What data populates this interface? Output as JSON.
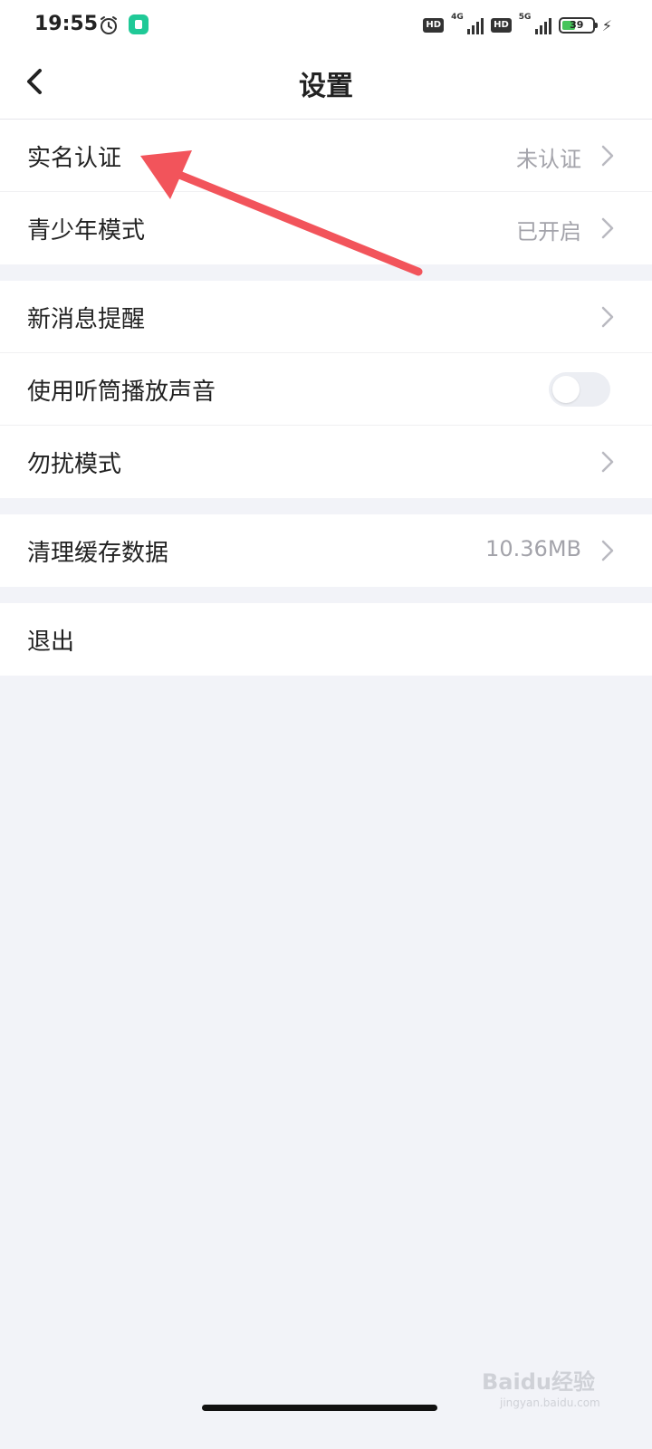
{
  "status_bar": {
    "time": "19:55",
    "hd_label_1": "HD",
    "network_1": "4G",
    "hd_label_2": "HD",
    "network_2": "5G",
    "battery_level": "39",
    "battery_color": "#45c45a",
    "icons": [
      "alarm-icon",
      "app-shield-icon",
      "signal-icon",
      "battery-icon",
      "charging-icon"
    ]
  },
  "header": {
    "title": "设置",
    "back_icon": "back-chevron-icon"
  },
  "groups": [
    {
      "items": [
        {
          "label": "实名认证",
          "value": "未认证",
          "control": "chevron"
        },
        {
          "label": "青少年模式",
          "value": "已开启",
          "control": "chevron"
        }
      ]
    },
    {
      "items": [
        {
          "label": "新消息提醒",
          "value": "",
          "control": "chevron"
        },
        {
          "label": "使用听筒播放声音",
          "value": "",
          "control": "toggle",
          "toggle_on": false
        },
        {
          "label": "勿扰模式",
          "value": "",
          "control": "chevron"
        }
      ]
    },
    {
      "items": [
        {
          "label": "清理缓存数据",
          "value": "10.36MB",
          "control": "chevron"
        }
      ]
    },
    {
      "items": [
        {
          "label": "退出",
          "value": "",
          "control": "none"
        }
      ]
    }
  ],
  "annotation": {
    "arrow_color": "#f2545b"
  },
  "watermark": {
    "text": "Baidu经验",
    "sub": "jingyan.baidu.com"
  }
}
